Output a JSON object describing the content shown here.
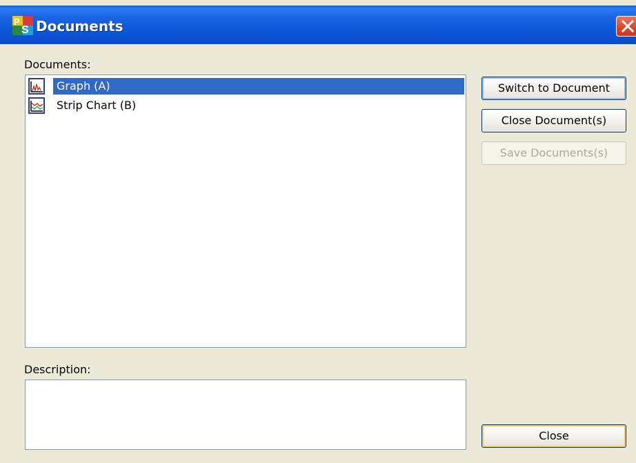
{
  "window": {
    "title": "Documents",
    "app_icon": "ps-app-icon",
    "close_icon": "close-icon"
  },
  "documents": {
    "label": "Documents:",
    "items": [
      {
        "label": "Graph (A)",
        "icon": "graph-document-icon",
        "selected": true
      },
      {
        "label": "Strip Chart (B)",
        "icon": "strip-chart-document-icon",
        "selected": false
      }
    ]
  },
  "description": {
    "label": "Description:",
    "value": ""
  },
  "buttons": {
    "switch_label": "Switch to Document",
    "close_docs_label": "Close Document(s)",
    "save_docs_label": "Save Documents(s)",
    "close_label": "Close"
  },
  "colors": {
    "titlebar": "#0A54D8",
    "selection": "#316AC5",
    "close_button": "#D9462B",
    "dialog_background": "#ECE9D8"
  }
}
